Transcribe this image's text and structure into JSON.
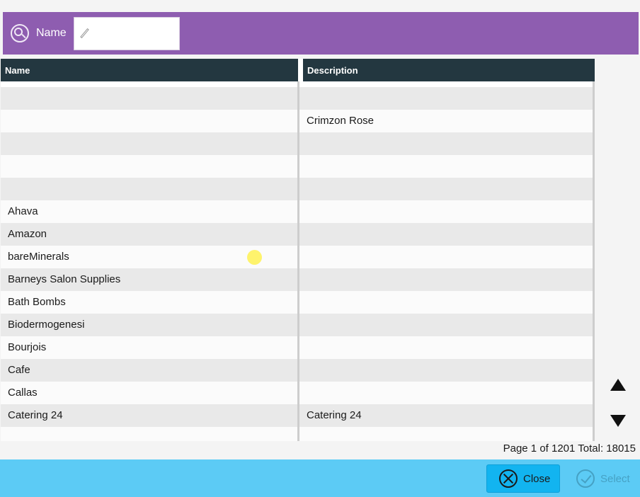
{
  "search": {
    "label": "Name",
    "value": "",
    "icon": "search-icon"
  },
  "grid": {
    "columns": [
      {
        "key": "name",
        "label": "Name"
      },
      {
        "key": "description",
        "label": "Description"
      }
    ],
    "rows": [
      {
        "name": "",
        "description": ""
      },
      {
        "name": "",
        "description": "Crimzon Rose"
      },
      {
        "name": "",
        "description": ""
      },
      {
        "name": "",
        "description": ""
      },
      {
        "name": "",
        "description": ""
      },
      {
        "name": "Ahava",
        "description": ""
      },
      {
        "name": "Amazon",
        "description": ""
      },
      {
        "name": "bareMinerals",
        "description": ""
      },
      {
        "name": "Barneys Salon Supplies",
        "description": ""
      },
      {
        "name": "Bath Bombs",
        "description": ""
      },
      {
        "name": "Biodermogenesi",
        "description": ""
      },
      {
        "name": "Bourjois",
        "description": ""
      },
      {
        "name": "Cafe",
        "description": ""
      },
      {
        "name": "Callas",
        "description": ""
      },
      {
        "name": "Catering 24",
        "description": "Catering 24"
      },
      {
        "name": "",
        "description": ""
      }
    ]
  },
  "pager": {
    "text": "Page 1 of 1201  Total: 18015"
  },
  "footer": {
    "close_label": "Close",
    "select_label": "Select"
  },
  "colors": {
    "header_bar": "#8e5db0",
    "grid_header": "#233740",
    "footer": "#5ccbf5",
    "close_button": "#12b4f0"
  }
}
